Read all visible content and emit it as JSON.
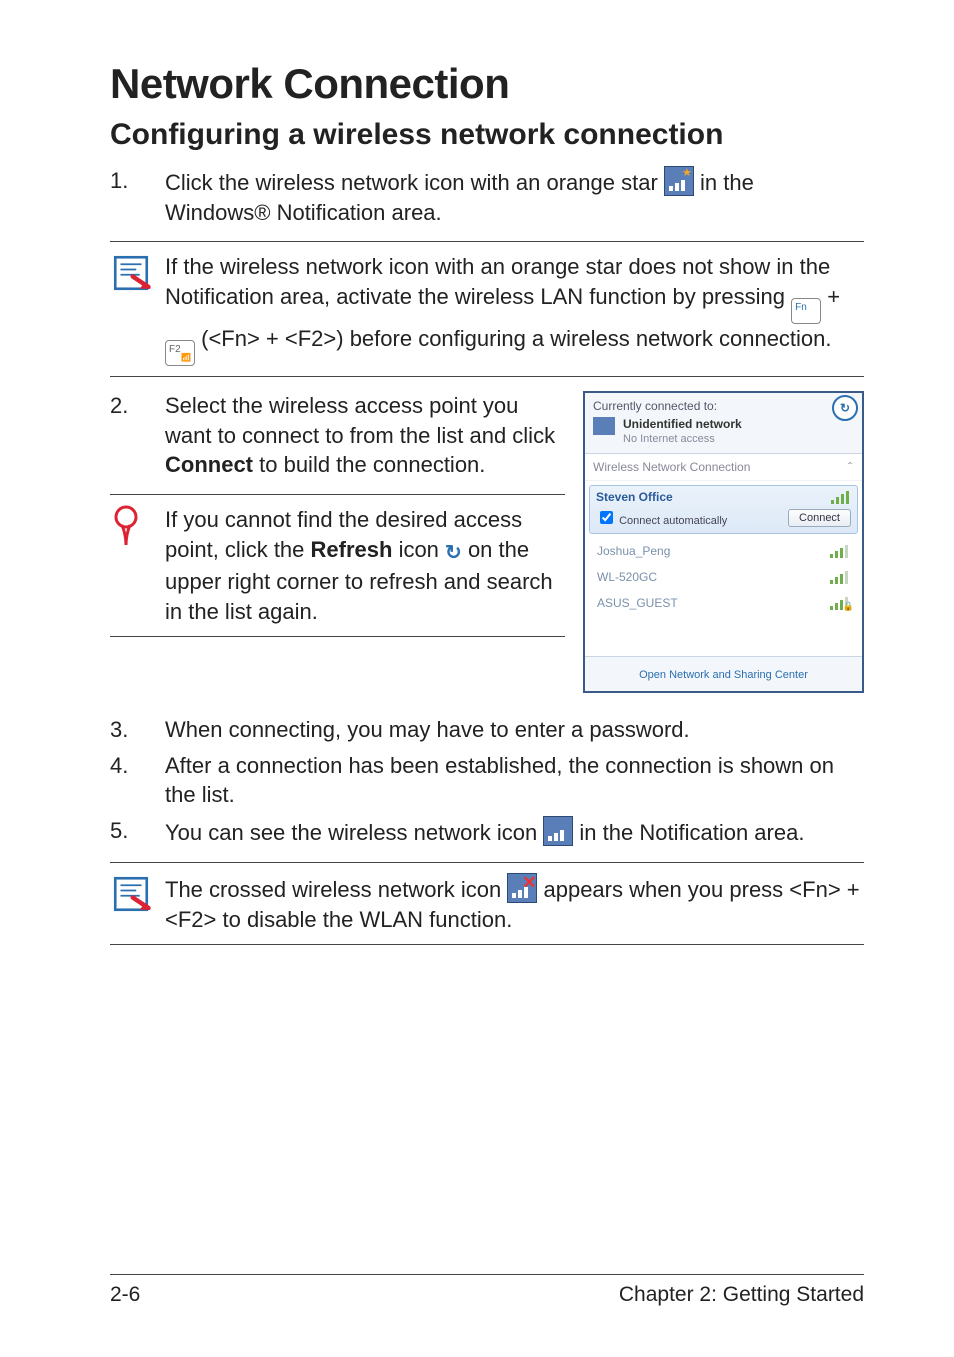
{
  "title": "Network Connection",
  "subtitle": "Configuring a wireless network connection",
  "steps": {
    "s1_num": "1.",
    "s1_a": "Click the wireless network icon with an orange star ",
    "s1_b": " in the Windows® Notification area.",
    "s2_num": "2.",
    "s2": "Select the wireless access point you want to connect to from the list and click ",
    "s2_bold": "Connect",
    "s2_end": " to build the connection.",
    "s3_num": "3.",
    "s3": "When connecting, you may have to enter a password.",
    "s4_num": "4.",
    "s4": "After a connection has been established, the connection is shown on the list.",
    "s5_num": "5.",
    "s5_a": "You can see the wireless network icon ",
    "s5_b": " in the Notification area."
  },
  "note1": {
    "a": "If the wireless network icon with an orange star does not show in the Notification area, activate the wireless LAN function by pressing ",
    "plus": " + ",
    "b": " (<Fn> + <F2>) before configuring a wireless network connection."
  },
  "key_fn": "Fn",
  "key_f2": "F2",
  "tip": {
    "a": "If you cannot find the desired access point, click the ",
    "bold": "Refresh",
    "b": " icon ",
    "c": " on the upper right corner to refresh and search in the list again."
  },
  "note2": {
    "a": "The crossed wireless network icon ",
    "b": " appears when you press <Fn> + <F2> to disable the WLAN function."
  },
  "footer_left": "2-6",
  "footer_right": "Chapter 2: Getting Started",
  "shot": {
    "currently": "Currently connected to:",
    "unid_title": "Unidentified network",
    "unid_sub": "No Internet access",
    "refresh_glyph": "↻",
    "section": "Wireless Network Connection",
    "dash": "ˆ",
    "selected": "Steven Office",
    "auto": "Connect automatically",
    "connect_btn": "Connect",
    "aps": [
      {
        "name": "Joshua_Peng",
        "lock": false
      },
      {
        "name": "WL-520GC",
        "lock": false
      },
      {
        "name": "ASUS_GUEST",
        "lock": true
      }
    ],
    "footer_link": "Open Network and Sharing Center"
  }
}
